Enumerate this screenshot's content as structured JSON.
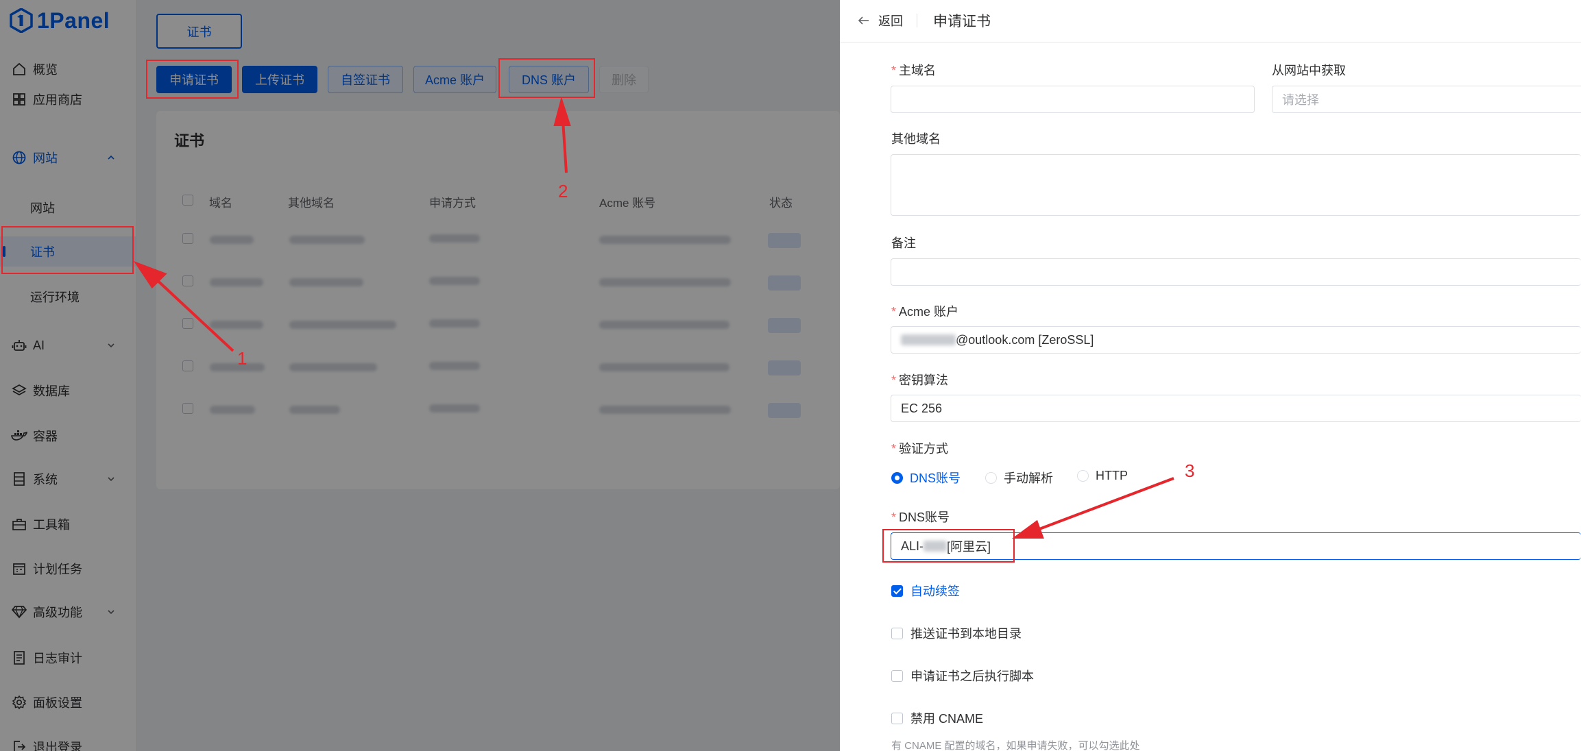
{
  "app": {
    "logo_text": "1Panel"
  },
  "sidebar": {
    "items": [
      {
        "label": "概览",
        "icon": "home-icon"
      },
      {
        "label": "应用商店",
        "icon": "grid-icon"
      },
      {
        "label": "网站",
        "icon": "globe-icon"
      },
      {
        "label": "AI",
        "icon": "robot-icon"
      },
      {
        "label": "数据库",
        "icon": "layers-icon"
      },
      {
        "label": "容器",
        "icon": "docker-icon"
      },
      {
        "label": "系统",
        "icon": "server-icon"
      },
      {
        "label": "工具箱",
        "icon": "toolbox-icon"
      },
      {
        "label": "计划任务",
        "icon": "calendar-icon"
      },
      {
        "label": "高级功能",
        "icon": "diamond-icon"
      },
      {
        "label": "日志审计",
        "icon": "log-icon"
      },
      {
        "label": "面板设置",
        "icon": "gear-icon"
      },
      {
        "label": "退出登录",
        "icon": "logout-icon"
      }
    ],
    "sub_items": [
      {
        "label": "网站"
      },
      {
        "label": "证书"
      },
      {
        "label": "运行环境"
      }
    ]
  },
  "main": {
    "tab_label": "证书",
    "toolbar": {
      "apply": "申请证书",
      "upload": "上传证书",
      "self_signed": "自签证书",
      "acme": "Acme 账户",
      "dns": "DNS 账户",
      "delete": "删除"
    },
    "card_title": "证书",
    "columns": [
      "域名",
      "其他域名",
      "申请方式",
      "Acme 账号",
      "状态"
    ]
  },
  "drawer": {
    "back": "返回",
    "title": "申请证书",
    "primary_domain": {
      "label": "主域名",
      "value": ""
    },
    "from_website": {
      "label": "从网站中获取",
      "placeholder": "请选择"
    },
    "other_domains": {
      "label": "其他域名"
    },
    "remark": {
      "label": "备注"
    },
    "acme_account": {
      "label": "Acme 账户",
      "value_suffix": "@outlook.com [ZeroSSL]"
    },
    "key_algorithm": {
      "label": "密钥算法",
      "value": "EC 256"
    },
    "verify_method": {
      "label": "验证方式",
      "options": [
        "DNS账号",
        "手动解析",
        "HTTP"
      ],
      "selected": "DNS账号"
    },
    "dns_account": {
      "label": "DNS账号",
      "value_prefix": "ALI-",
      "value_suffix": " [阿里云]"
    },
    "checkboxes": [
      {
        "label": "自动续签",
        "checked": true
      },
      {
        "label": "推送证书到本地目录",
        "checked": false
      },
      {
        "label": "申请证书之后执行脚本",
        "checked": false
      },
      {
        "label": "禁用 CNAME",
        "checked": false
      }
    ],
    "cname_hint": "有 CNAME 配置的域名，如果申请失败，可以勾选此处"
  },
  "annotations": {
    "n1": "1",
    "n2": "2",
    "n3": "3",
    "color": "#e5262c"
  },
  "colors": {
    "primary": "#005eeb",
    "danger": "#f56c6c"
  }
}
